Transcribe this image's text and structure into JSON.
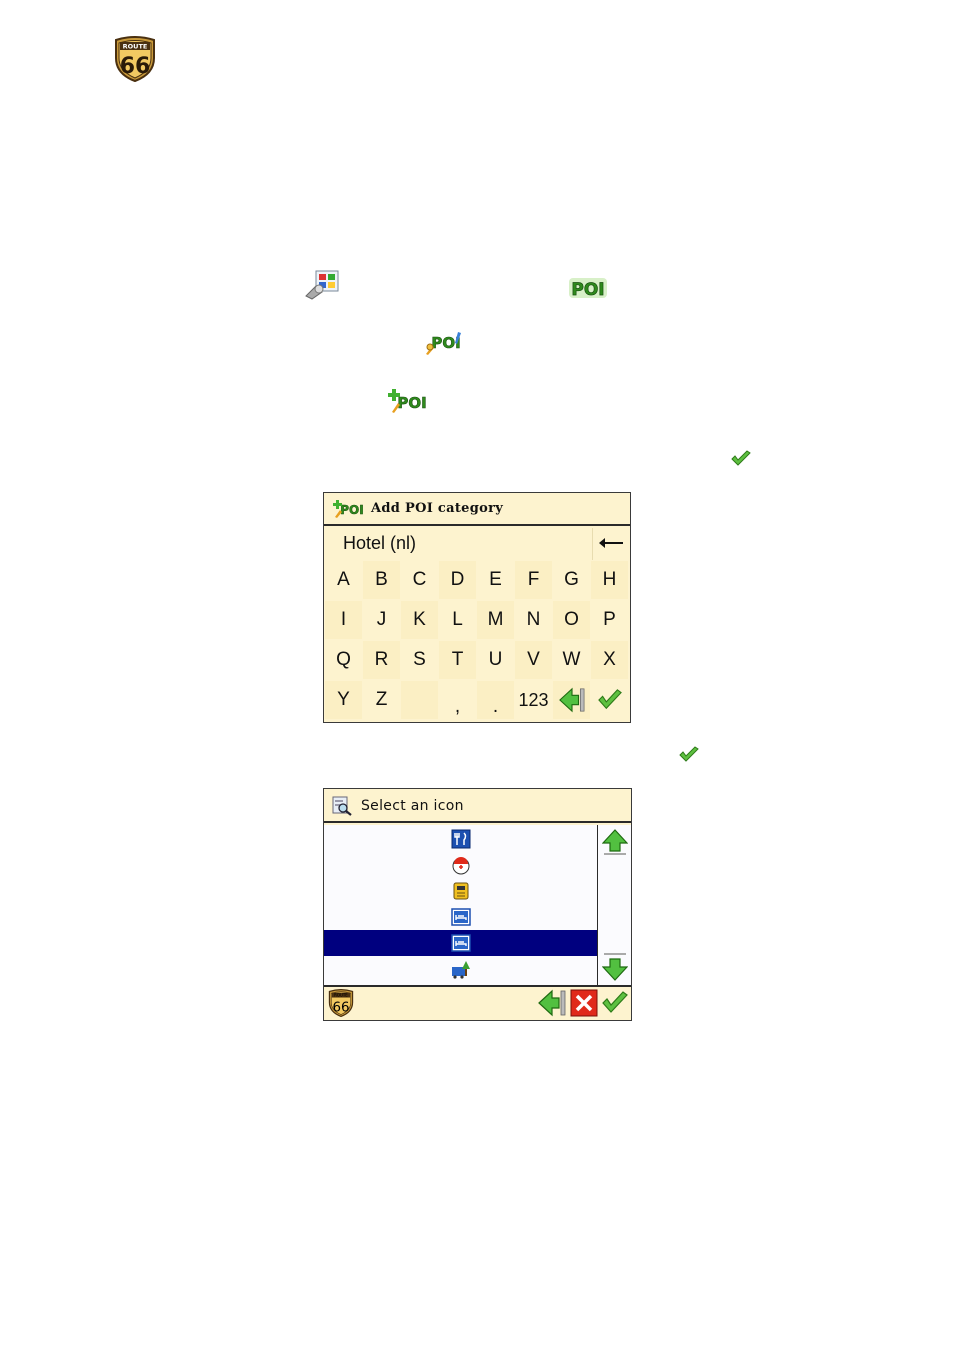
{
  "header": {
    "logo_top": "ROUTE",
    "logo_number": "66"
  },
  "colors": {
    "panel_bg": "#fdf3cf",
    "selection": "#00007f",
    "accent_green": "#48b030"
  },
  "inline_icons": [
    "settings-icon",
    "poi-icon",
    "edit-poi-icon",
    "add-poi-icon",
    "check-icon"
  ],
  "add_poi_window": {
    "title": "Add POI category",
    "input_value": "Hotel (nl)",
    "keys": [
      [
        "A",
        "B",
        "C",
        "D",
        "E",
        "F",
        "G",
        "H"
      ],
      [
        "I",
        "J",
        "K",
        "L",
        "M",
        "N",
        "O",
        "P"
      ],
      [
        "Q",
        "R",
        "S",
        "T",
        "U",
        "V",
        "W",
        "X"
      ],
      [
        "Y",
        "Z",
        "",
        ",",
        ".",
        "123",
        "",
        ""
      ]
    ]
  },
  "select_icon_window": {
    "title": "Select an icon",
    "items": [
      "restaurant-icon",
      "emergency-icon",
      "phone-icon",
      "hotel-icon",
      "hotel-icon",
      "camping-icon"
    ],
    "selected_index": 4,
    "footer_logo_top": "ROUTE",
    "footer_logo_number": "66"
  }
}
